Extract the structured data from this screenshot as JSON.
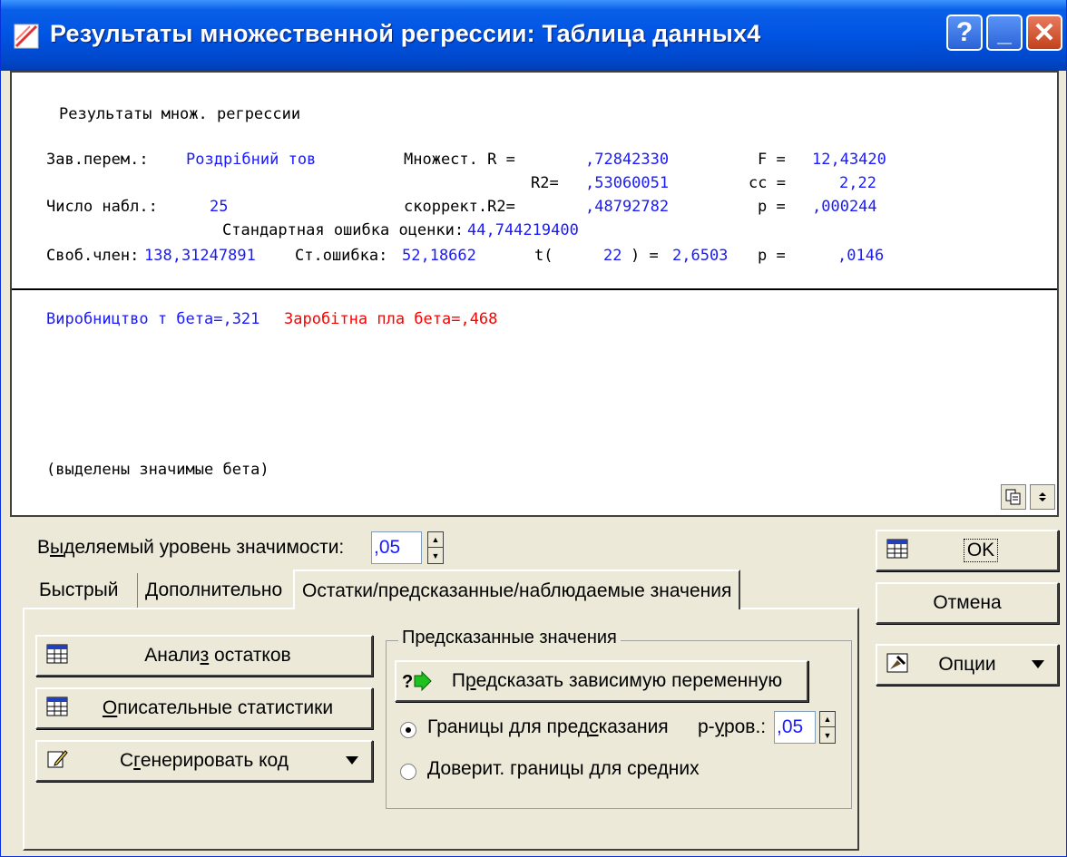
{
  "window": {
    "title": "Результаты множественной регрессии: Таблица данных4",
    "help_label": "?",
    "minimize_label": "_",
    "close_label": "✕"
  },
  "results": {
    "heading": "Результаты множ. регрессии",
    "dep_var_label": "Зав.перем.:",
    "dep_var_value": "Роздрібний тов",
    "mult_r_label": "Множест. R =",
    "mult_r_value": ",72842330",
    "f_label": "F =",
    "f_value": "12,43420",
    "r2_label": "R2=",
    "r2_value": ",53060051",
    "cc_label": "cc =",
    "cc_value": "2,22",
    "n_label": "Число набл.:",
    "n_value": "25",
    "adj_r2_label": "скоррект.R2=",
    "adj_r2_value": ",48792782",
    "p_label": "p =",
    "p_value": ",000244",
    "se_label": "Стандартная ошибка оценки:",
    "se_value": "44,744219400",
    "intercept_label": "Своб.член:",
    "intercept_value": "138,31247891",
    "st_err_label": "Ст.ошибка:",
    "st_err_value": "52,18662",
    "t_label": "t(",
    "t_df": "22",
    "t_eq": ") =",
    "t_value": "2,6503",
    "p2_label": "p =",
    "p2_value": ",0146",
    "beta1": "Виробництво т бета=,321",
    "beta2": "Заробітна пла бета=,468",
    "footnote": "(выделены значимые бета)"
  },
  "controls": {
    "significance_label_pre": "В",
    "significance_label_u": "ы",
    "significance_label_post": "деляемый уровень значимости:",
    "significance_value": ",05",
    "tabs": [
      {
        "label": "Быстрый"
      },
      {
        "label": "Дополнительно"
      },
      {
        "label": "Остатки/предсказанные/наблюдаемые значения"
      }
    ],
    "residuals_button_pre": "Анали",
    "residuals_button_u": "з",
    "residuals_button_post": " остатков",
    "descriptive_button_u": "О",
    "descriptive_button_post": "писательные статистики",
    "generate_button_pre": "С",
    "generate_button_u": "г",
    "generate_button_post": "енерировать код",
    "predicted_group_title": "Предсказанные значения",
    "predict_button_pre": "П",
    "predict_button_u": "р",
    "predict_button_post": "едсказать зависимую переменную",
    "radio1_pre": "Границы для пред",
    "radio1_u": "с",
    "radio1_post": "казания",
    "p_level_pre": "p-",
    "p_level_u": "у",
    "p_level_post": "ров.:",
    "p_level_value": ",05",
    "radio2_label": "Доверит. границы для средних"
  },
  "side_buttons": {
    "ok_label": "OK",
    "cancel_label": "Отмена",
    "options_label": "Опции"
  },
  "colors": {
    "accent_blue": "#1a1aff",
    "highlight_red": "#ff0000",
    "titlebar": "#0054e3"
  }
}
